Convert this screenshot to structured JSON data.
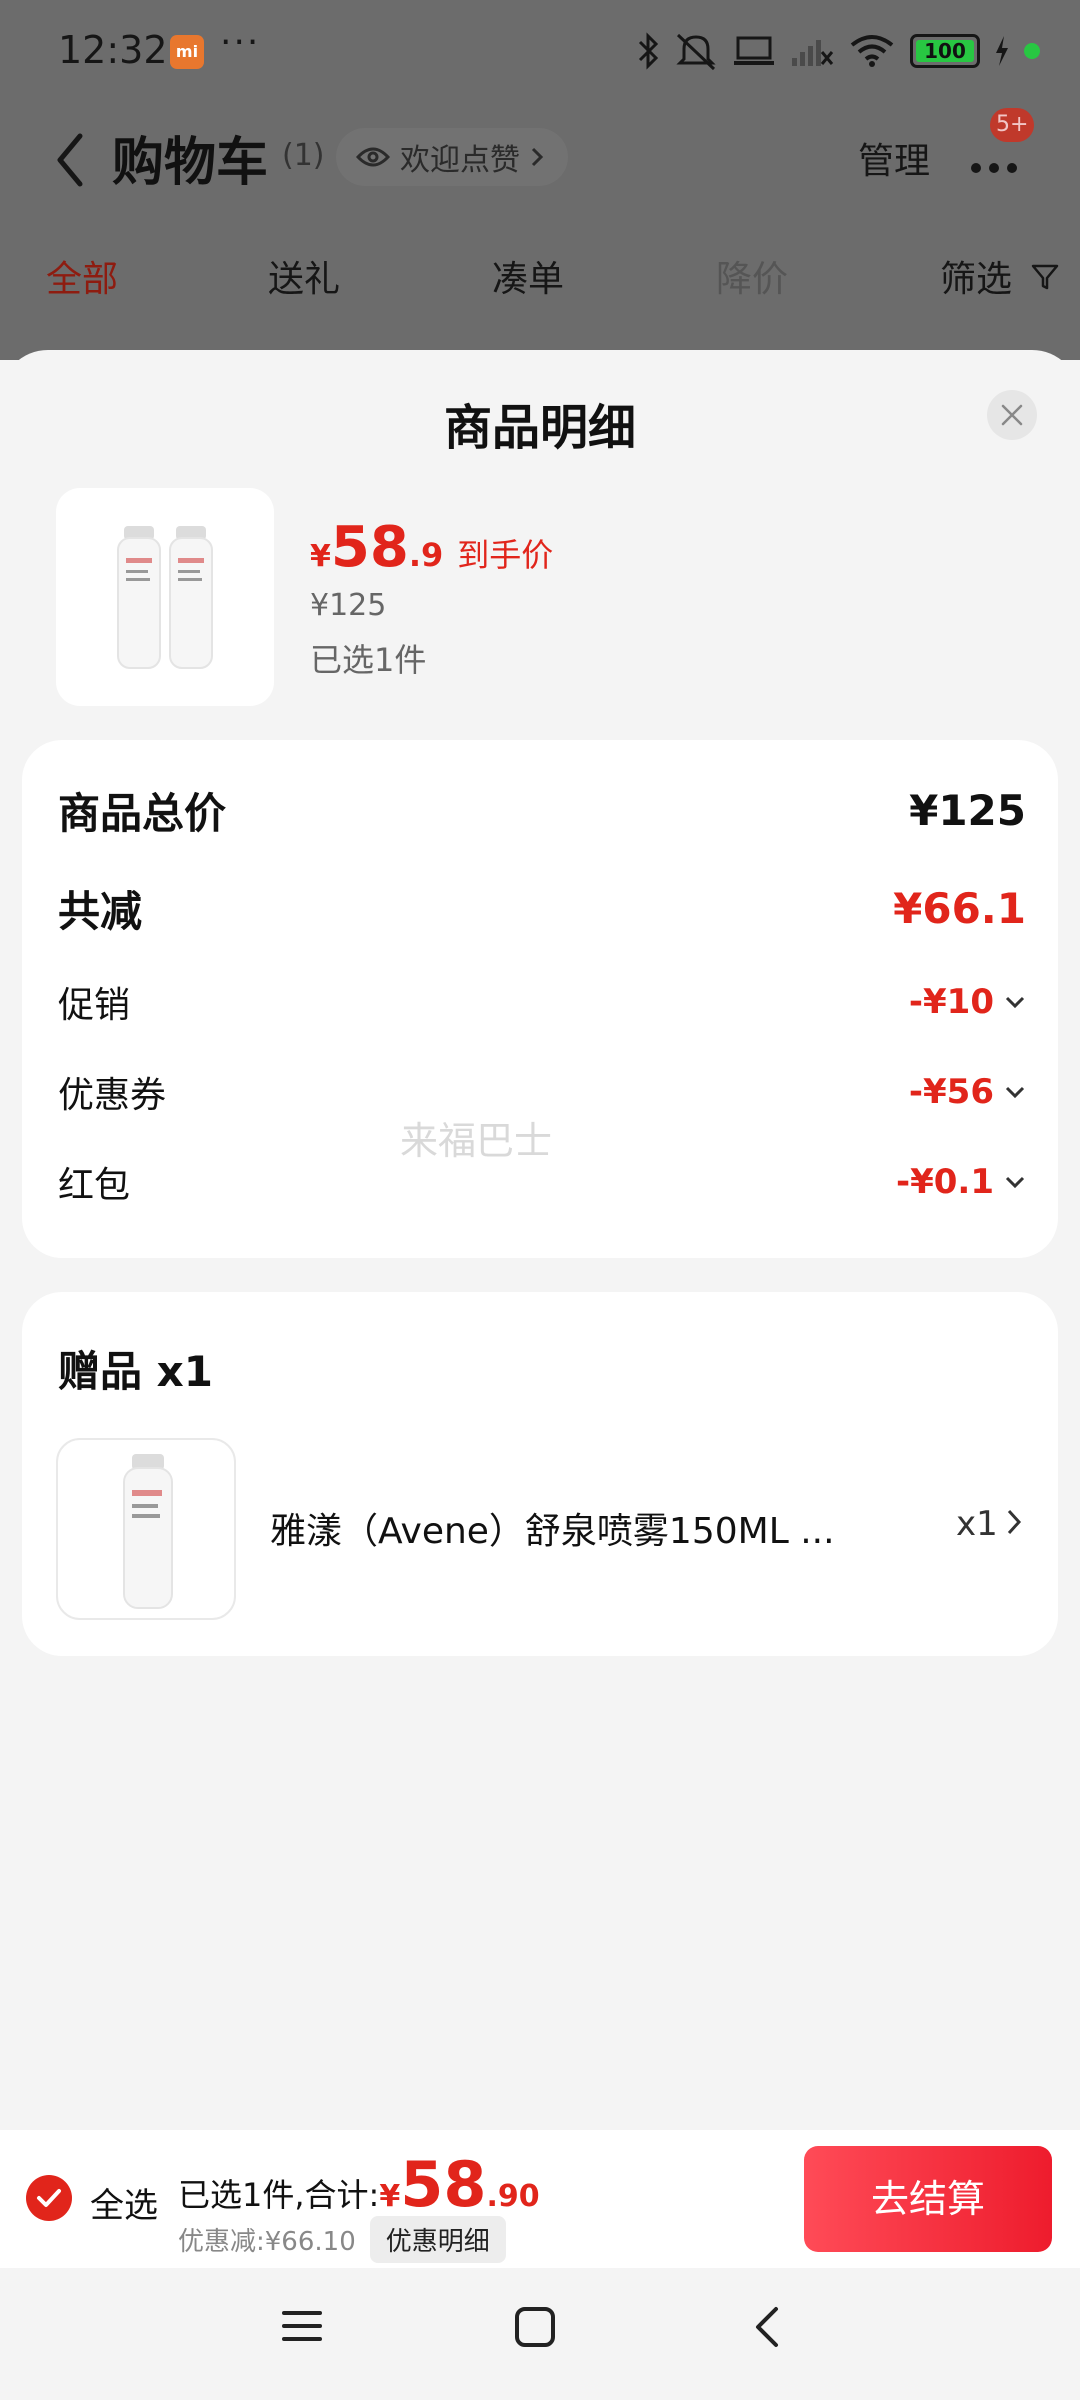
{
  "status_bar": {
    "time": "12:32",
    "mi_badge": "mi",
    "dots": "···",
    "battery": "100",
    "icons": [
      "bluetooth-icon",
      "mute-icon",
      "laptop-icon",
      "signal-icon",
      "wifi-icon",
      "battery-icon",
      "charging-icon"
    ]
  },
  "cart_header": {
    "title": "购物车",
    "count": "(1)",
    "welcome": "欢迎点赞",
    "manage": "管理",
    "more_badge": "5+"
  },
  "filter_tabs": [
    {
      "label": "全部",
      "state": "active"
    },
    {
      "label": "送礼",
      "state": "normal"
    },
    {
      "label": "凑单",
      "state": "normal"
    },
    {
      "label": "降价",
      "state": "muted"
    },
    {
      "label": "筛选",
      "state": "normal"
    }
  ],
  "sheet": {
    "title": "商品明细",
    "product": {
      "price_symbol": "¥",
      "price_int": "58",
      "price_dec": ".9",
      "price_tag": "到手价",
      "original_price": "¥125",
      "selected": "已选1件"
    },
    "price_breakdown": {
      "total_label": "商品总价",
      "total_value": "¥125",
      "reduce_label": "共减",
      "reduce_value": "¥66.1",
      "items": [
        {
          "label": "促销",
          "value": "-¥10"
        },
        {
          "label": "优惠券",
          "value": "-¥56"
        },
        {
          "label": "红包",
          "value": "-¥0.1"
        }
      ]
    },
    "watermark": "来福巴士",
    "gift": {
      "title": "赠品 x1",
      "name": "雅漾（Avene）舒泉喷雾150ML ...",
      "qty": "x1"
    }
  },
  "bottom_bar": {
    "select_all": "全选",
    "summary_label": "已选1件,合计:",
    "total_symbol": "¥",
    "total_int": "58",
    "total_dec": ".90",
    "discount": "优惠减:¥66.10",
    "detail_button": "优惠明细",
    "checkout": "去结算"
  },
  "colors": {
    "accent": "#e1251b",
    "overlay": "#6c6c6c",
    "sheet_bg": "#f4f4f4"
  }
}
